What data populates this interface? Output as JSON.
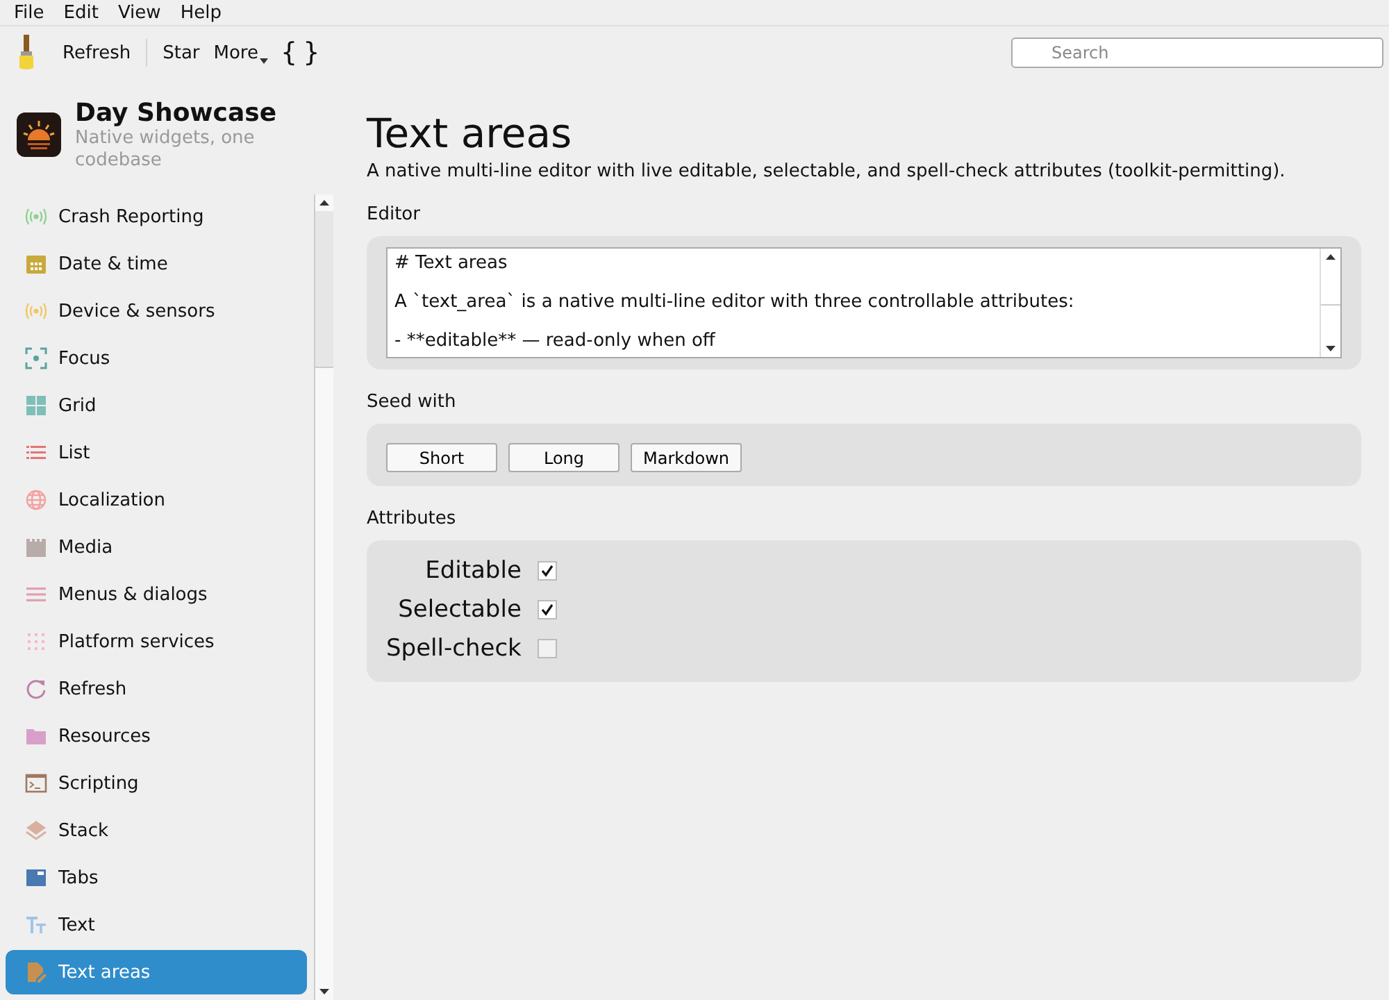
{
  "menu": [
    "File",
    "Edit",
    "View",
    "Help"
  ],
  "toolbar": {
    "buttons": [
      "Refresh",
      "Star"
    ],
    "more": "More",
    "braces": "{ }",
    "search": {
      "placeholder": "Search"
    }
  },
  "app": {
    "title": "Day Showcase",
    "subtitle": "Native widgets, one codebase"
  },
  "sidebar": {
    "items": [
      {
        "label": "Crash Reporting",
        "kind": "broadcast",
        "color": "#8fd18f",
        "selected": false
      },
      {
        "label": "Date & time",
        "kind": "calendar",
        "color": "#c9a93a",
        "selected": false
      },
      {
        "label": "Device & sensors",
        "kind": "broadcast",
        "color": "#f0c860",
        "selected": false
      },
      {
        "label": "Focus",
        "kind": "focus",
        "color": "#5aa3a0",
        "selected": false
      },
      {
        "label": "Grid",
        "kind": "grid",
        "color": "#7fbfb8",
        "selected": false
      },
      {
        "label": "List",
        "kind": "list",
        "color": "#e57373",
        "selected": false
      },
      {
        "label": "Localization",
        "kind": "globe",
        "color": "#f4a0a0",
        "selected": false
      },
      {
        "label": "Media",
        "kind": "clapper",
        "color": "#b8aca8",
        "selected": false
      },
      {
        "label": "Menus & dialogs",
        "kind": "menu",
        "color": "#e0a0b0",
        "selected": false
      },
      {
        "label": "Platform services",
        "kind": "dots",
        "color": "#f4b8c8",
        "selected": false
      },
      {
        "label": "Refresh",
        "kind": "refresh",
        "color": "#c080a8",
        "selected": false
      },
      {
        "label": "Resources",
        "kind": "folder",
        "color": "#d8a0c8",
        "selected": false
      },
      {
        "label": "Scripting",
        "kind": "terminal",
        "color": "#a07860",
        "selected": false
      },
      {
        "label": "Stack",
        "kind": "stack",
        "color": "#d8b0a0",
        "selected": false
      },
      {
        "label": "Tabs",
        "kind": "tabs",
        "color": "#4a78b0",
        "selected": false
      },
      {
        "label": "Text",
        "kind": "text",
        "color": "#a0c4e8",
        "selected": false
      },
      {
        "label": "Text areas",
        "kind": "edit",
        "color": "#c89050",
        "selected": true
      }
    ]
  },
  "page": {
    "title": "Text areas",
    "description": "A native multi-line editor with live editable, selectable, and spell-check attributes (toolkit-permitting).",
    "editor": {
      "label": "Editor",
      "lines": [
        "# Text areas",
        "A `text_area` is a native multi-line editor with three controllable attributes:",
        "- **editable** — read-only when off"
      ]
    },
    "seed": {
      "label": "Seed with",
      "buttons": [
        "Short",
        "Long",
        "Markdown"
      ]
    },
    "attributes": {
      "label": "Attributes",
      "items": [
        {
          "label": "Editable",
          "checked": true
        },
        {
          "label": "Selectable",
          "checked": true
        },
        {
          "label": "Spell-check",
          "checked": false
        }
      ]
    }
  }
}
